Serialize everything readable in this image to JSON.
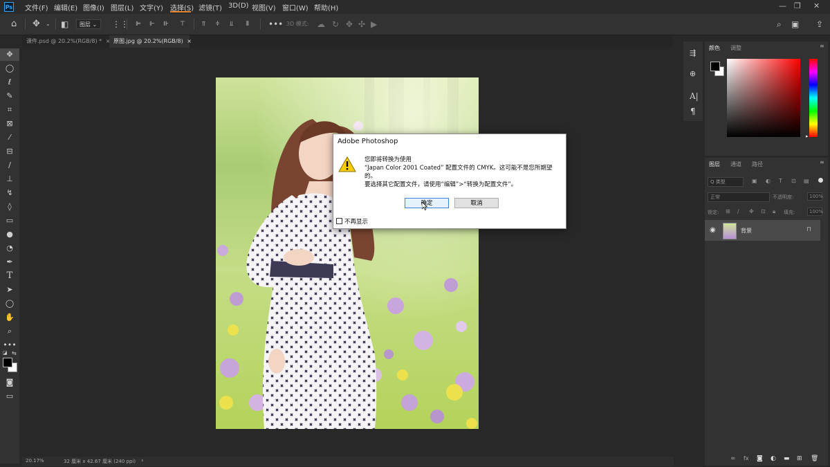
{
  "menubar": {
    "logo": "Ps",
    "items": [
      "文件(F)",
      "编辑(E)",
      "图像(I)",
      "图层(L)",
      "文字(Y)",
      "选择(S)",
      "滤镜(T)",
      "3D(D)",
      "视图(V)",
      "窗口(W)",
      "帮助(H)"
    ],
    "window_controls": {
      "minimize": "—",
      "restore": "❐",
      "close": "✕"
    }
  },
  "options_bar": {
    "layer_select": "图层",
    "mode_3d_label": "3D 模式:"
  },
  "tabs": [
    {
      "label": "课件.psd @ 20.2%(RGB/8) *",
      "close": "×"
    },
    {
      "label": "原图.jpg @ 20.2%(RGB/8)",
      "close": "×"
    }
  ],
  "status": {
    "zoom": "20.17%",
    "info": "32 厘米 x 42.67 厘米 (240 ppi)",
    "arrow": "›"
  },
  "color_panel": {
    "tabs": [
      "颜色",
      "调整"
    ],
    "accent": "#ff0000"
  },
  "layers_panel": {
    "tabs": [
      "图层",
      "通道",
      "路径"
    ],
    "filter_label": "Q 类型",
    "blend_mode": "正常",
    "opacity_label": "不透明度:",
    "opacity_value": "100%",
    "lock_label": "锁定:",
    "fill_label": "填充:",
    "fill_value": "100%",
    "layers": [
      {
        "name": "背景",
        "visible": true,
        "locked": true
      }
    ]
  },
  "dialog": {
    "title": "Adobe Photoshop",
    "line1": "您即将转换为使用",
    "line2": "“Japan Color 2001 Coated” 配置文件的 CMYK。这可能不是您所期望",
    "line3": "的。",
    "line4": "要选择其它配置文件，请使用“编辑”>“转换为配置文件”。",
    "ok_label": "确定",
    "cancel_label": "取消",
    "dont_show_label": "不再显示"
  }
}
